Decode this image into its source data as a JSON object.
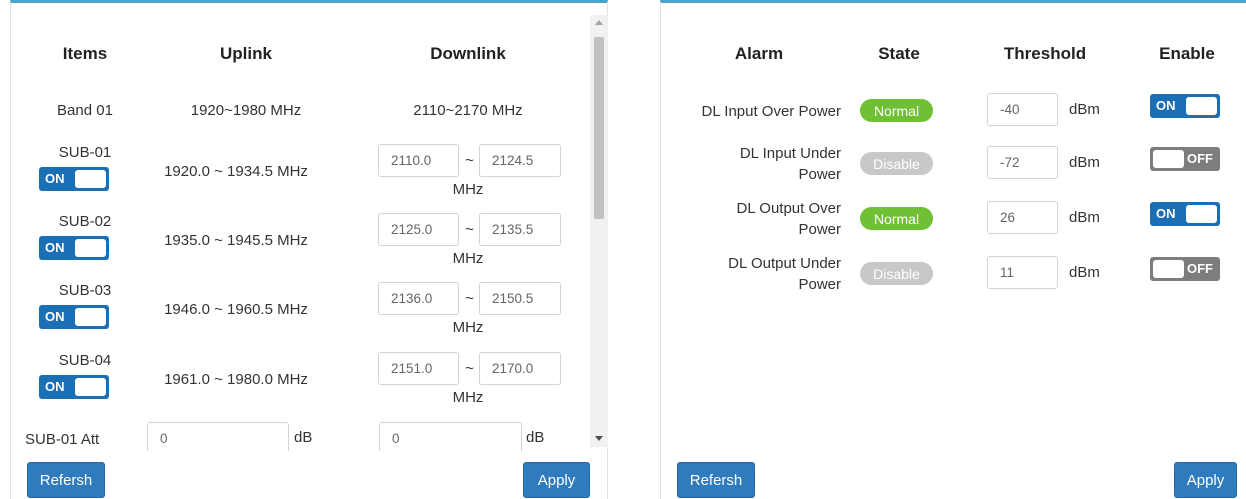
{
  "band_panel": {
    "headers": {
      "items": "Items",
      "uplink": "Uplink",
      "downlink": "Downlink"
    },
    "band": {
      "label": "Band 01",
      "uplink": "1920~1980 MHz",
      "downlink": "2110~2170 MHz"
    },
    "subs": [
      {
        "label": "SUB-01",
        "toggle": "ON",
        "uplink": "1920.0 ~ 1934.5 MHz",
        "dl_start": "2110.0",
        "dl_end": "2124.5"
      },
      {
        "label": "SUB-02",
        "toggle": "ON",
        "uplink": "1935.0 ~ 1945.5 MHz",
        "dl_start": "2125.0",
        "dl_end": "2135.5"
      },
      {
        "label": "SUB-03",
        "toggle": "ON",
        "uplink": "1946.0 ~ 1960.5 MHz",
        "dl_start": "2136.0",
        "dl_end": "2150.5"
      },
      {
        "label": "SUB-04",
        "toggle": "ON",
        "uplink": "1961.0 ~ 1980.0 MHz",
        "dl_start": "2151.0",
        "dl_end": "2170.0"
      }
    ],
    "range_sep": "~",
    "unit_mhz": "MHz",
    "att": {
      "label": "SUB-01 Att",
      "uplink_value": "0",
      "downlink_value": "0",
      "unit": "dB"
    },
    "refresh_label": "Refersh",
    "apply_label": "Apply"
  },
  "alarm_panel": {
    "headers": {
      "alarm": "Alarm",
      "state": "State",
      "threshold": "Threshold",
      "enable": "Enable"
    },
    "unit": "dBm",
    "rows": [
      {
        "line1": "DL Input Over Power",
        "line2": "",
        "state": "Normal",
        "threshold": "-40",
        "enable": "ON"
      },
      {
        "line1": "DL Input Under",
        "line2": "Power",
        "state": "Disable",
        "threshold": "-72",
        "enable": "OFF"
      },
      {
        "line1": "DL Output Over",
        "line2": "Power",
        "state": "Normal",
        "threshold": "26",
        "enable": "ON"
      },
      {
        "line1": "DL Output Under",
        "line2": "Power",
        "state": "Disable",
        "threshold": "11",
        "enable": "OFF"
      }
    ],
    "refresh_label": "Refersh",
    "apply_label": "Apply"
  },
  "colors": {
    "panel_accent": "#4aa3c9",
    "toggle_on": "#1a6fb5",
    "toggle_off": "#7d7d7d",
    "state_normal": "#6fc034",
    "state_disable": "#c8c8c8",
    "button": "#2f7bbd"
  },
  "icons": {
    "scroll_up": "scroll-up-arrow-icon",
    "scroll_down": "scroll-down-arrow-icon"
  }
}
